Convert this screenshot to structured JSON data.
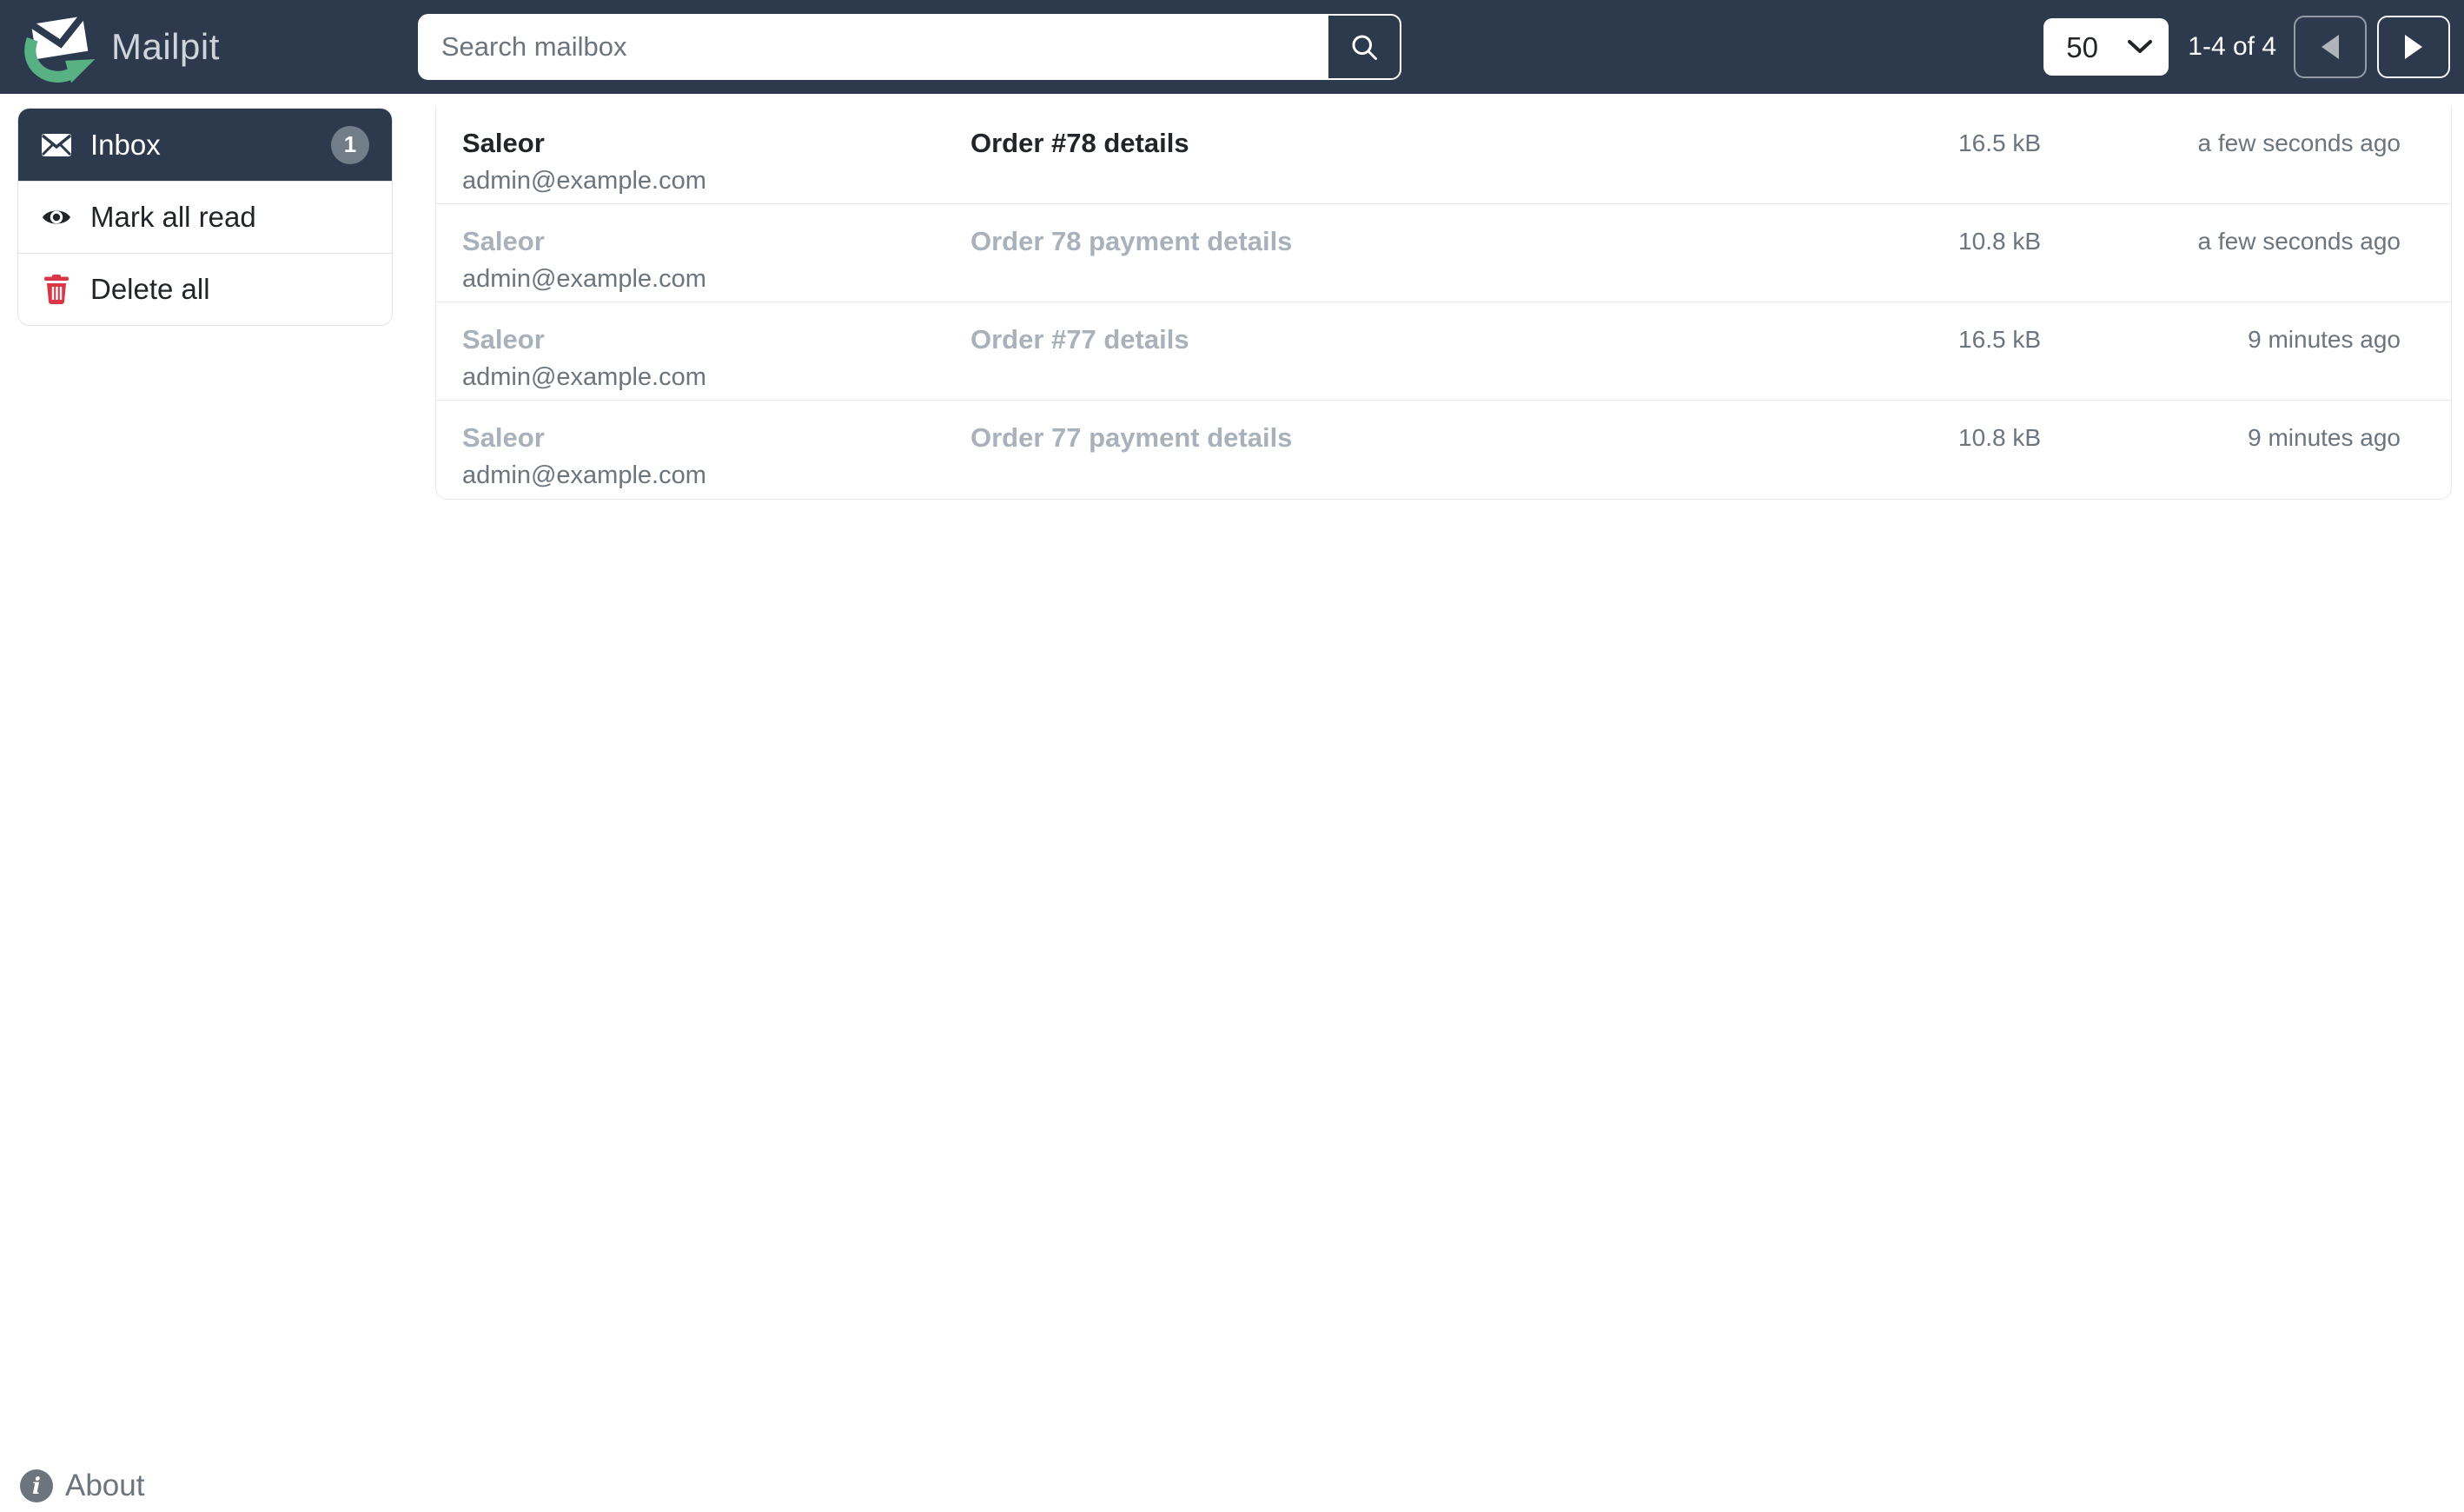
{
  "navbar": {
    "brand": "Mailpit",
    "search": {
      "placeholder": "Search mailbox",
      "value": ""
    },
    "per_page": "50",
    "pagination_label": "1-4 of 4"
  },
  "sidebar": {
    "items": [
      {
        "label": "Inbox",
        "badge": "1",
        "active": true
      },
      {
        "label": "Mark all read"
      },
      {
        "label": "Delete all"
      }
    ]
  },
  "messages": [
    {
      "from_name": "Saleor",
      "from_email": "admin@example.com",
      "subject": "Order #78 details",
      "size": "16.5 kB",
      "time": "a few seconds ago",
      "unread": true
    },
    {
      "from_name": "Saleor",
      "from_email": "admin@example.com",
      "subject": "Order 78 payment details",
      "size": "10.8 kB",
      "time": "a few seconds ago",
      "unread": false
    },
    {
      "from_name": "Saleor",
      "from_email": "admin@example.com",
      "subject": "Order #77 details",
      "size": "16.5 kB",
      "time": "9 minutes ago",
      "unread": false
    },
    {
      "from_name": "Saleor",
      "from_email": "admin@example.com",
      "subject": "Order 77 payment details",
      "size": "10.8 kB",
      "time": "9 minutes ago",
      "unread": false
    }
  ],
  "footer": {
    "about_label": "About"
  },
  "icons": {
    "brand": "mailpit-envelope-arrow",
    "search": "magnifier",
    "inbox": "envelope",
    "mark_all_read": "eye",
    "delete_all": "trash",
    "per_page": "chevron-down",
    "prev_page": "triangle-left",
    "next_page": "triangle-right",
    "about": "info-circle"
  },
  "colors": {
    "navbar_bg": "#2d3a4d",
    "logo_green": "#57b183",
    "badge_bg": "#717d89",
    "danger_red": "#dc3545",
    "unread_text": "#212529",
    "read_text": "#a9b1ba",
    "muted_text": "#6c757d"
  }
}
